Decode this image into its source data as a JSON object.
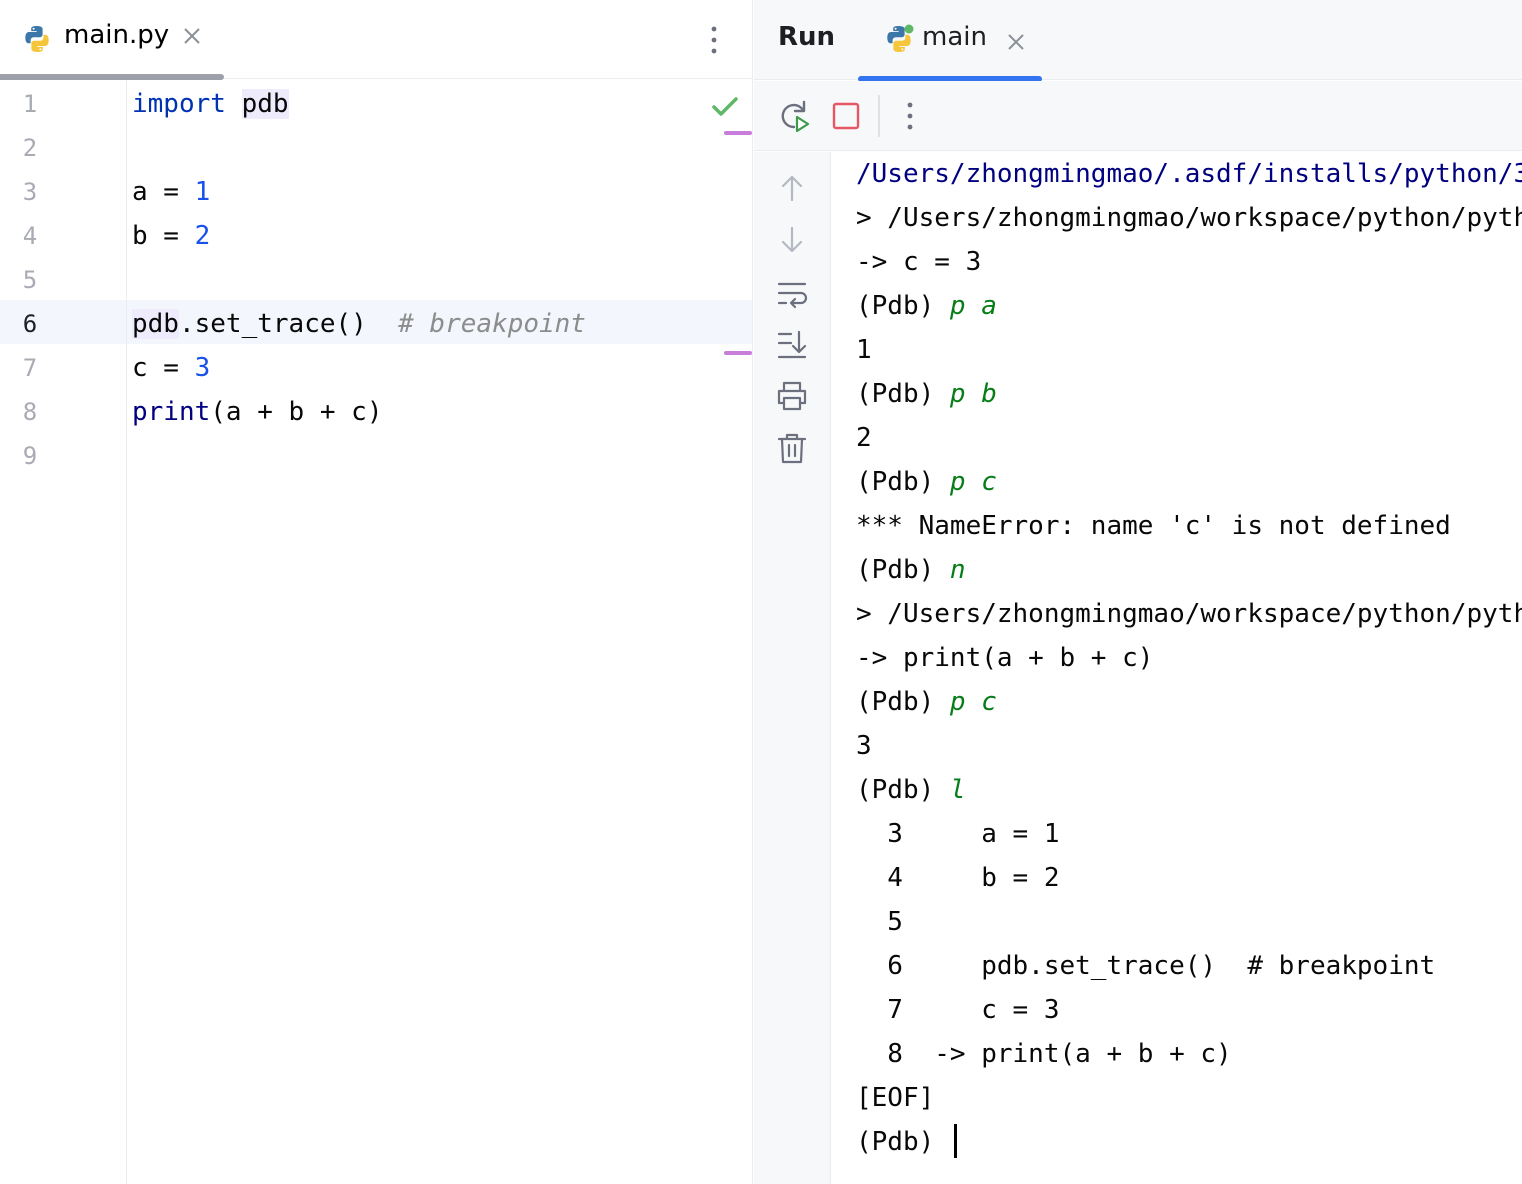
{
  "editor": {
    "tab": {
      "label": "main.py",
      "icon": "python-icon",
      "close_icon": "close-icon"
    },
    "menu_icon": "kebab-menu-icon",
    "inspection_icon": "checkmark-icon",
    "line_numbers": [
      "1",
      "2",
      "3",
      "4",
      "5",
      "6",
      "7",
      "8",
      "9"
    ],
    "current_line": "6",
    "code": {
      "l1_kw": "import",
      "l1_mod": "pdb",
      "l3_var": "a = ",
      "l3_num": "1",
      "l4_var": "b = ",
      "l4_num": "2",
      "l6_obj": "pdb",
      "l6_call": ".set_trace()",
      "l6_comment": "# breakpoint",
      "l7_var": "c = ",
      "l7_num": "3",
      "l8_fn": "print",
      "l8_args": "(a + b + c)"
    }
  },
  "run": {
    "title": "Run",
    "tab": {
      "label": "main",
      "icon": "python-running-icon",
      "close_icon": "close-icon"
    },
    "toolbar": {
      "rerun_icon": "rerun-icon",
      "stop_icon": "stop-icon",
      "menu_icon": "kebab-menu-icon"
    },
    "side_toolbar": [
      "arrow-up-icon",
      "arrow-down-icon",
      "soft-wrap-icon",
      "scroll-to-end-icon",
      "print-icon",
      "trash-icon"
    ],
    "console": {
      "path": "/Users/zhongmingmao/.asdf/installs/python/3",
      "loc1": "> /Users/zhongmingmao/workspace/python/pyth",
      "arrow1": "-> c = 3",
      "prompt": "(Pdb) ",
      "cmd_pa": "p a",
      "out_1": "1",
      "cmd_pb": "p b",
      "out_2": "2",
      "cmd_pc": "p c",
      "err": "*** NameError: name 'c' is not defined",
      "cmd_n": "n",
      "loc2": "> /Users/zhongmingmao/workspace/python/pyth",
      "arrow2": "-> print(a + b + c)",
      "cmd_pc2": "p c",
      "out_3": "3",
      "cmd_l": "l",
      "list1": "  3     a = 1",
      "list2": "  4     b = 2",
      "list3": "  5",
      "list4": "  6     pdb.set_trace()  # breakpoint",
      "list5": "  7     c = 3",
      "list6": "  8  -> print(a + b + c)",
      "eof": "[EOF]",
      "final_prompt": "(Pdb) "
    }
  },
  "colors": {
    "keyword": "#0033b3",
    "number": "#1750eb",
    "comment": "#8c8c8c",
    "pdb_command": "#067d17",
    "accent_tab": "#3574f0",
    "stop_red": "#e55765"
  }
}
